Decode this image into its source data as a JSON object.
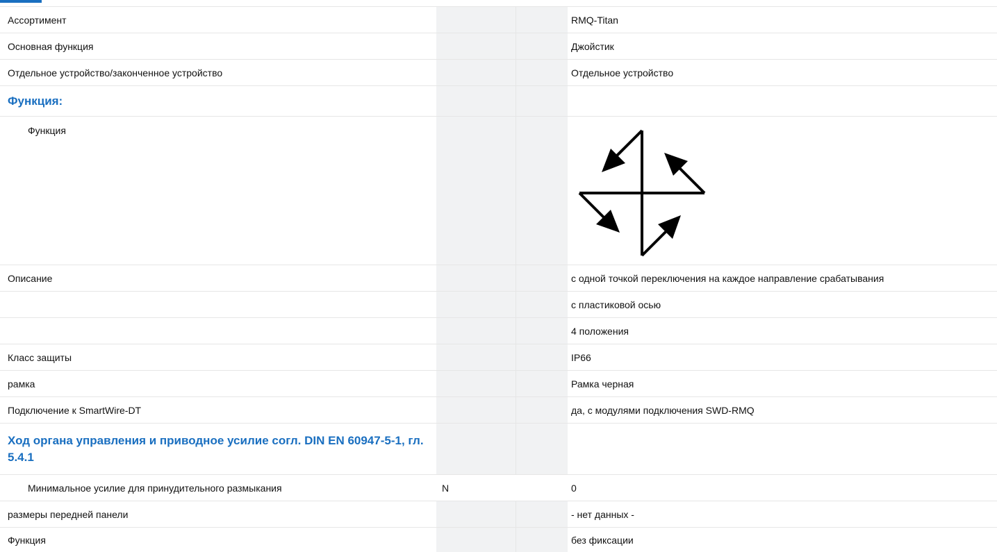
{
  "rows": [
    {
      "label": "Ассортимент",
      "unit": "",
      "value": "RMQ-Titan"
    },
    {
      "label": "Основная функция",
      "unit": "",
      "value": "Джойстик"
    },
    {
      "label": "Отдельное устройство/законченное устройство",
      "unit": "",
      "value": "Отдельное устройство"
    },
    {
      "label": "Функция:",
      "unit": "",
      "value": ""
    },
    {
      "label": "Функция",
      "unit": "",
      "value": ""
    },
    {
      "label": "Описание",
      "unit": "",
      "value": "с одной точкой переключения на каждое направление срабатывания"
    },
    {
      "label": "",
      "unit": "",
      "value": "с пластиковой осью"
    },
    {
      "label": "",
      "unit": "",
      "value": "4 положения"
    },
    {
      "label": "Класс защиты",
      "unit": "",
      "value": "IP66"
    },
    {
      "label": "рамка",
      "unit": "",
      "value": "Рамка черная"
    },
    {
      "label": "Подключение к SmartWire-DT",
      "unit": "",
      "value": "да, с модулями подключения SWD-RMQ"
    },
    {
      "label": "Ход органа управления и приводное усилие согл. DIN EN 60947-5-1, гл. 5.4.1",
      "unit": "",
      "value": ""
    },
    {
      "label": "Минимальное усилие для принудительного размыкания",
      "unit": "N",
      "value": "0"
    },
    {
      "label": "размеры передней панели",
      "unit": "",
      "value": "- нет данных -"
    },
    {
      "label": "Функция",
      "unit": "",
      "value": "без фиксации"
    }
  ],
  "function_symbol": "joystick-4-positions-icon",
  "colors": {
    "section_heading": "#1a6fc0",
    "unit_column_bg": "#f1f2f3",
    "row_divider": "#e6e6e6"
  }
}
